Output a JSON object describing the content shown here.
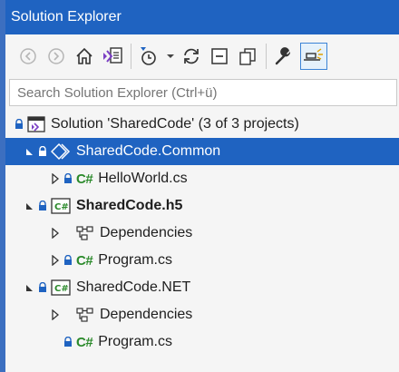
{
  "window": {
    "title": "Solution Explorer"
  },
  "toolbar": {
    "buttons": [
      {
        "name": "back-icon"
      },
      {
        "name": "forward-icon"
      },
      {
        "name": "home-icon"
      },
      {
        "name": "switch-views-icon"
      },
      {
        "name": "pending-changes-filter-icon"
      },
      {
        "name": "dropdown-arrow-icon"
      },
      {
        "name": "sync-icon"
      },
      {
        "name": "collapse-all-icon"
      },
      {
        "name": "show-all-files-icon"
      },
      {
        "name": "properties-wrench-icon"
      },
      {
        "name": "preview-selected-items-icon"
      }
    ]
  },
  "search": {
    "placeholder": "Search Solution Explorer (Ctrl+ü)"
  },
  "tree": {
    "solution": {
      "label": "Solution 'SharedCode' (3 of 3 projects)"
    },
    "project_common": {
      "label": "SharedCode.Common"
    },
    "common_helloworld": {
      "label": "HelloWorld.cs",
      "badge": "C#"
    },
    "project_h5": {
      "label": "SharedCode.h5",
      "badge": "C#"
    },
    "h5_dependencies": {
      "label": "Dependencies"
    },
    "h5_program": {
      "label": "Program.cs",
      "badge": "C#"
    },
    "project_net": {
      "label": "SharedCode.NET",
      "badge": "C#"
    },
    "net_dependencies": {
      "label": "Dependencies"
    },
    "net_program": {
      "label": "Program.cs",
      "badge": "C#"
    }
  },
  "colors": {
    "accent": "#1f63c1",
    "csharp": "#2b8a2b",
    "lock": "#1f63c1"
  }
}
